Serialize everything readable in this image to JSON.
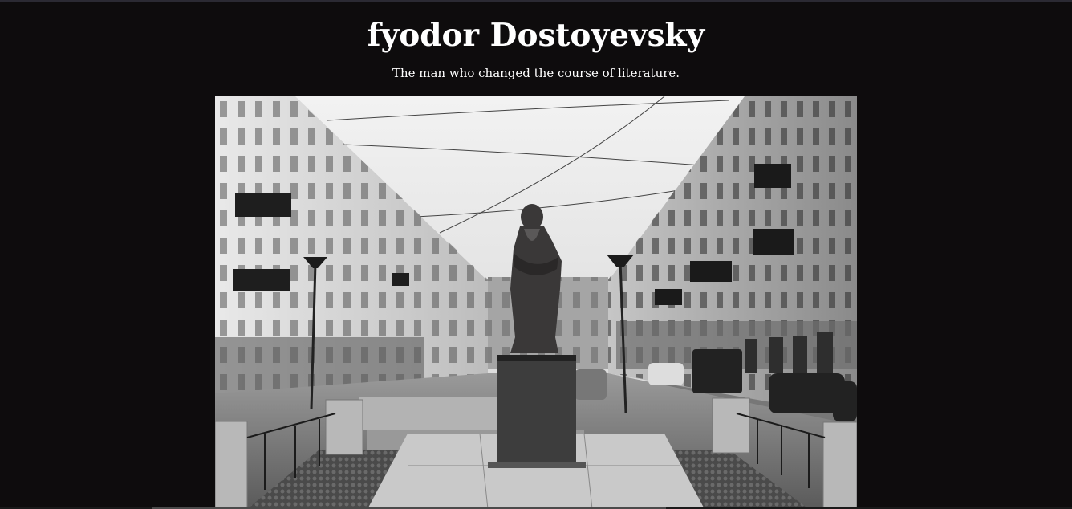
{
  "page": {
    "title": "fyodor Dostoyevsky",
    "subtitle": "The man who changed the course of literature.",
    "background_color": "#0e0c0d",
    "text_color": "#ffffff"
  },
  "hero_image": {
    "alt": "Black and white photograph of the Dostoyevsky monument on a city street",
    "tone": "grayscale"
  }
}
